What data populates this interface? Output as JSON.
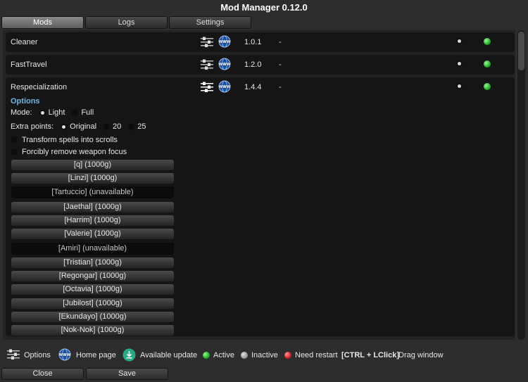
{
  "window": {
    "title": "Mod Manager 0.12.0"
  },
  "tabs": [
    {
      "label": "Mods",
      "active": true
    },
    {
      "label": "Logs",
      "active": false
    },
    {
      "label": "Settings",
      "active": false
    }
  ],
  "mods": [
    {
      "name": "Cleaner",
      "version": "1.0.1",
      "notes": "-",
      "status": "active",
      "options_icon": "sliders-icon",
      "home_icon": "www-globe-icon"
    },
    {
      "name": "FastTravel",
      "version": "1.2.0",
      "notes": "-",
      "status": "active",
      "options_icon": "sliders-icon",
      "home_icon": "www-globe-icon"
    },
    {
      "name": "Respecialization",
      "version": "1.4.4",
      "notes": "-",
      "status": "active",
      "options_icon": "sliders-icon",
      "home_icon": "www-globe-icon"
    }
  ],
  "options": {
    "title": "Options",
    "mode": {
      "label": "Mode:",
      "choices": [
        "Light",
        "Full"
      ],
      "selected": "Light"
    },
    "extra_points": {
      "label": "Extra points:",
      "choices": [
        "Original",
        "20",
        "25"
      ],
      "selected": "Original"
    },
    "checks": [
      {
        "label": "Transform spells into scrolls",
        "checked": false
      },
      {
        "label": "Forcibly remove weapon focus",
        "checked": false
      }
    ],
    "npcs": [
      {
        "label": "[q] (1000g)",
        "available": true
      },
      {
        "label": "[Linzi] (1000g)",
        "available": true
      },
      {
        "label": "[Tartuccio] (unavailable)",
        "available": false
      },
      {
        "label": "[Jaethal] (1000g)",
        "available": true
      },
      {
        "label": "[Harrim] (1000g)",
        "available": true
      },
      {
        "label": "[Valerie] (1000g)",
        "available": true
      },
      {
        "label": "[Amiri] (unavailable)",
        "available": false
      },
      {
        "label": "[Tristian] (1000g)",
        "available": true
      },
      {
        "label": "[Regongar] (1000g)",
        "available": true
      },
      {
        "label": "[Octavia] (1000g)",
        "available": true
      },
      {
        "label": "[Jubilost] (1000g)",
        "available": true
      },
      {
        "label": "[Ekundayo] (1000g)",
        "available": true
      },
      {
        "label": "[Nok-Nok] (1000g)",
        "available": true
      }
    ]
  },
  "legend": {
    "options": "Options",
    "home": "Home page",
    "update": "Available update",
    "active": "Active",
    "inactive": "Inactive",
    "restart": "Need restart",
    "shortcut": "[CTRL + LClick]",
    "drag": "Drag window"
  },
  "buttons": {
    "close": "Close",
    "save": "Save"
  },
  "colors": {
    "accent_blue": "#6fb7e6",
    "active_green": "#22b022",
    "need_restart_red": "#d02020",
    "inactive_grey": "#9a9a9a",
    "update_teal": "#2aa784"
  }
}
